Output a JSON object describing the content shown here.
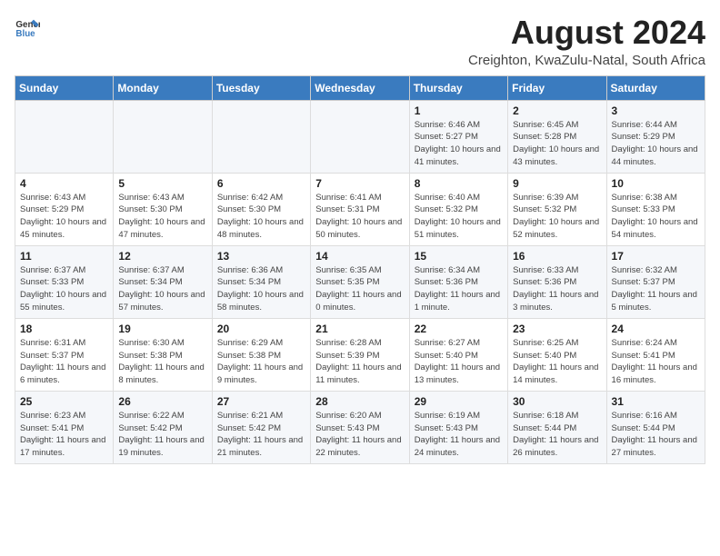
{
  "logo": {
    "text_general": "General",
    "text_blue": "Blue"
  },
  "title": {
    "month_year": "August 2024",
    "location": "Creighton, KwaZulu-Natal, South Africa"
  },
  "weekdays": [
    "Sunday",
    "Monday",
    "Tuesday",
    "Wednesday",
    "Thursday",
    "Friday",
    "Saturday"
  ],
  "weeks": [
    [
      {
        "day": "",
        "sunrise": "",
        "sunset": "",
        "daylight": ""
      },
      {
        "day": "",
        "sunrise": "",
        "sunset": "",
        "daylight": ""
      },
      {
        "day": "",
        "sunrise": "",
        "sunset": "",
        "daylight": ""
      },
      {
        "day": "",
        "sunrise": "",
        "sunset": "",
        "daylight": ""
      },
      {
        "day": "1",
        "sunrise": "Sunrise: 6:46 AM",
        "sunset": "Sunset: 5:27 PM",
        "daylight": "Daylight: 10 hours and 41 minutes."
      },
      {
        "day": "2",
        "sunrise": "Sunrise: 6:45 AM",
        "sunset": "Sunset: 5:28 PM",
        "daylight": "Daylight: 10 hours and 43 minutes."
      },
      {
        "day": "3",
        "sunrise": "Sunrise: 6:44 AM",
        "sunset": "Sunset: 5:29 PM",
        "daylight": "Daylight: 10 hours and 44 minutes."
      }
    ],
    [
      {
        "day": "4",
        "sunrise": "Sunrise: 6:43 AM",
        "sunset": "Sunset: 5:29 PM",
        "daylight": "Daylight: 10 hours and 45 minutes."
      },
      {
        "day": "5",
        "sunrise": "Sunrise: 6:43 AM",
        "sunset": "Sunset: 5:30 PM",
        "daylight": "Daylight: 10 hours and 47 minutes."
      },
      {
        "day": "6",
        "sunrise": "Sunrise: 6:42 AM",
        "sunset": "Sunset: 5:30 PM",
        "daylight": "Daylight: 10 hours and 48 minutes."
      },
      {
        "day": "7",
        "sunrise": "Sunrise: 6:41 AM",
        "sunset": "Sunset: 5:31 PM",
        "daylight": "Daylight: 10 hours and 50 minutes."
      },
      {
        "day": "8",
        "sunrise": "Sunrise: 6:40 AM",
        "sunset": "Sunset: 5:32 PM",
        "daylight": "Daylight: 10 hours and 51 minutes."
      },
      {
        "day": "9",
        "sunrise": "Sunrise: 6:39 AM",
        "sunset": "Sunset: 5:32 PM",
        "daylight": "Daylight: 10 hours and 52 minutes."
      },
      {
        "day": "10",
        "sunrise": "Sunrise: 6:38 AM",
        "sunset": "Sunset: 5:33 PM",
        "daylight": "Daylight: 10 hours and 54 minutes."
      }
    ],
    [
      {
        "day": "11",
        "sunrise": "Sunrise: 6:37 AM",
        "sunset": "Sunset: 5:33 PM",
        "daylight": "Daylight: 10 hours and 55 minutes."
      },
      {
        "day": "12",
        "sunrise": "Sunrise: 6:37 AM",
        "sunset": "Sunset: 5:34 PM",
        "daylight": "Daylight: 10 hours and 57 minutes."
      },
      {
        "day": "13",
        "sunrise": "Sunrise: 6:36 AM",
        "sunset": "Sunset: 5:34 PM",
        "daylight": "Daylight: 10 hours and 58 minutes."
      },
      {
        "day": "14",
        "sunrise": "Sunrise: 6:35 AM",
        "sunset": "Sunset: 5:35 PM",
        "daylight": "Daylight: 11 hours and 0 minutes."
      },
      {
        "day": "15",
        "sunrise": "Sunrise: 6:34 AM",
        "sunset": "Sunset: 5:36 PM",
        "daylight": "Daylight: 11 hours and 1 minute."
      },
      {
        "day": "16",
        "sunrise": "Sunrise: 6:33 AM",
        "sunset": "Sunset: 5:36 PM",
        "daylight": "Daylight: 11 hours and 3 minutes."
      },
      {
        "day": "17",
        "sunrise": "Sunrise: 6:32 AM",
        "sunset": "Sunset: 5:37 PM",
        "daylight": "Daylight: 11 hours and 5 minutes."
      }
    ],
    [
      {
        "day": "18",
        "sunrise": "Sunrise: 6:31 AM",
        "sunset": "Sunset: 5:37 PM",
        "daylight": "Daylight: 11 hours and 6 minutes."
      },
      {
        "day": "19",
        "sunrise": "Sunrise: 6:30 AM",
        "sunset": "Sunset: 5:38 PM",
        "daylight": "Daylight: 11 hours and 8 minutes."
      },
      {
        "day": "20",
        "sunrise": "Sunrise: 6:29 AM",
        "sunset": "Sunset: 5:38 PM",
        "daylight": "Daylight: 11 hours and 9 minutes."
      },
      {
        "day": "21",
        "sunrise": "Sunrise: 6:28 AM",
        "sunset": "Sunset: 5:39 PM",
        "daylight": "Daylight: 11 hours and 11 minutes."
      },
      {
        "day": "22",
        "sunrise": "Sunrise: 6:27 AM",
        "sunset": "Sunset: 5:40 PM",
        "daylight": "Daylight: 11 hours and 13 minutes."
      },
      {
        "day": "23",
        "sunrise": "Sunrise: 6:25 AM",
        "sunset": "Sunset: 5:40 PM",
        "daylight": "Daylight: 11 hours and 14 minutes."
      },
      {
        "day": "24",
        "sunrise": "Sunrise: 6:24 AM",
        "sunset": "Sunset: 5:41 PM",
        "daylight": "Daylight: 11 hours and 16 minutes."
      }
    ],
    [
      {
        "day": "25",
        "sunrise": "Sunrise: 6:23 AM",
        "sunset": "Sunset: 5:41 PM",
        "daylight": "Daylight: 11 hours and 17 minutes."
      },
      {
        "day": "26",
        "sunrise": "Sunrise: 6:22 AM",
        "sunset": "Sunset: 5:42 PM",
        "daylight": "Daylight: 11 hours and 19 minutes."
      },
      {
        "day": "27",
        "sunrise": "Sunrise: 6:21 AM",
        "sunset": "Sunset: 5:42 PM",
        "daylight": "Daylight: 11 hours and 21 minutes."
      },
      {
        "day": "28",
        "sunrise": "Sunrise: 6:20 AM",
        "sunset": "Sunset: 5:43 PM",
        "daylight": "Daylight: 11 hours and 22 minutes."
      },
      {
        "day": "29",
        "sunrise": "Sunrise: 6:19 AM",
        "sunset": "Sunset: 5:43 PM",
        "daylight": "Daylight: 11 hours and 24 minutes."
      },
      {
        "day": "30",
        "sunrise": "Sunrise: 6:18 AM",
        "sunset": "Sunset: 5:44 PM",
        "daylight": "Daylight: 11 hours and 26 minutes."
      },
      {
        "day": "31",
        "sunrise": "Sunrise: 6:16 AM",
        "sunset": "Sunset: 5:44 PM",
        "daylight": "Daylight: 11 hours and 27 minutes."
      }
    ]
  ]
}
